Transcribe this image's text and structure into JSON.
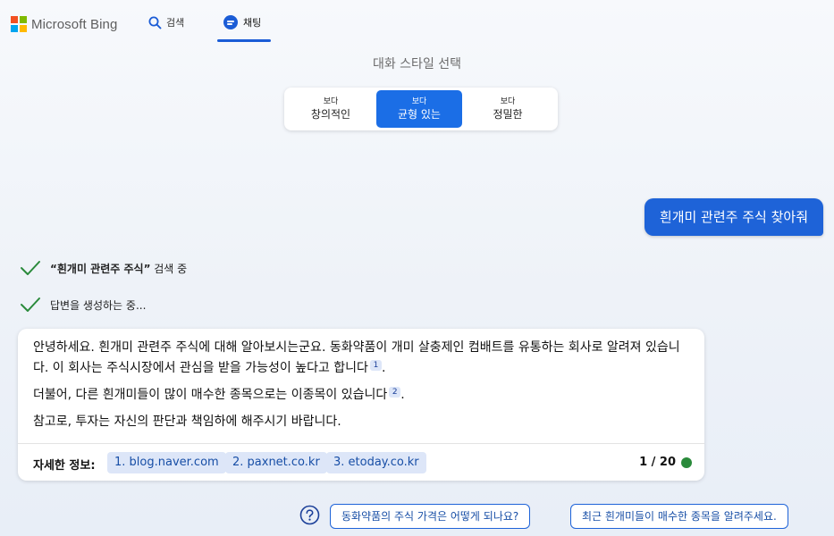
{
  "header": {
    "logo_text": "Microsoft Bing",
    "logo_colors": [
      "#f25022",
      "#7fba00",
      "#00a4ef",
      "#ffb900"
    ],
    "tabs": [
      {
        "label": "검색",
        "icon": "search-icon",
        "active": false
      },
      {
        "label": "채팅",
        "icon": "chat-icon",
        "active": true
      }
    ]
  },
  "style_selector": {
    "title": "대화 스타일 선택",
    "options": [
      {
        "small": "보다",
        "label": "창의적인",
        "active": false
      },
      {
        "small": "보다",
        "label": "균형 있는",
        "active": true
      },
      {
        "small": "보다",
        "label": "정밀한",
        "active": false
      }
    ]
  },
  "user_message": "흰개미 관련주 주식 찾아줘",
  "status": {
    "searching_term": "“흰개미 관련주 주식”",
    "searching_suffix": " 검색 중",
    "generating": "답변을 생성하는 중..."
  },
  "answer": {
    "p1": "안녕하세요. 흰개미 관련주 주식에 대해 알아보시는군요. 동화약품이 개미 살충제인 컴배트를 유통하는 회사로 알려져 있습니다. 이 회사는 주식시장에서 관심을 받을 가능성이 높다고 합니다",
    "p1_cite": "1",
    "p2": "더불어, 다른 흰개미들이 많이 매수한 종목으로는 이종목이 있습니다",
    "p2_cite": "2",
    "p3": "참고로, 투자는 자신의 판단과 책임하에 해주시기 바랍니다.",
    "period": ".",
    "footer_label": "자세한 정보:",
    "sources": [
      "1. blog.naver.com",
      "2. paxnet.co.kr",
      "3. etoday.co.kr"
    ],
    "counter": "1 / 20",
    "counter_color": "#2a8a3b"
  },
  "suggestions": [
    "동화약품의 주식 가격은 어떻게 되나요?",
    "최근 흰개미들이 매수한 종목을 알려주세요."
  ],
  "colors": {
    "accent": "#1e63d8",
    "source_bg": "#dde6f8"
  }
}
